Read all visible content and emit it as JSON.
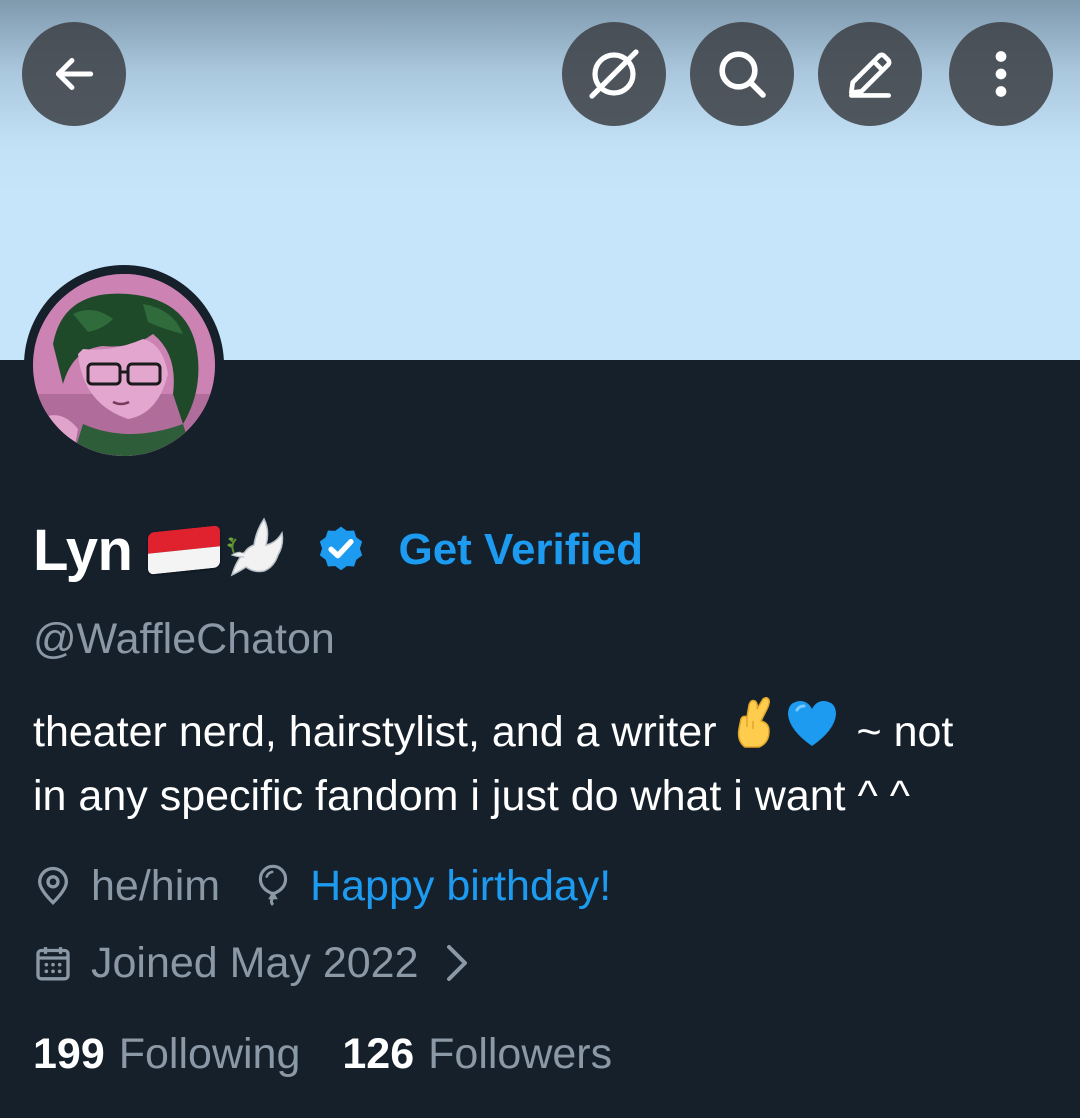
{
  "header": {
    "back_icon": "arrow-left-icon",
    "grok_icon": "grok-icon",
    "search_icon": "search-icon",
    "edit_icon": "pencil-icon",
    "more_icon": "more-vertical-icon"
  },
  "profile": {
    "display_name": "Lyn",
    "name_emojis": [
      "indonesia-flag",
      "dove"
    ],
    "verified_badge": "verified-badge-icon",
    "get_verified_label": "Get Verified",
    "handle": "@WaffleChaton",
    "bio": {
      "line1_text": "theater nerd, hairstylist, and a writer",
      "line1_emojis": [
        "crossed-fingers",
        "blue-heart"
      ],
      "line1_tail": "~ not",
      "line2": "in any specific fandom i just do what i want ^ ^"
    },
    "location": "he/him",
    "birthday_link": "Happy birthday!",
    "joined": "Joined May 2022",
    "following_count": "199",
    "following_label": "Following",
    "followers_count": "126",
    "followers_label": "Followers"
  },
  "colors": {
    "background": "#15202b",
    "accent": "#1d9bf0",
    "secondary_text": "#8b98a5",
    "banner": "#c6e5fb"
  }
}
